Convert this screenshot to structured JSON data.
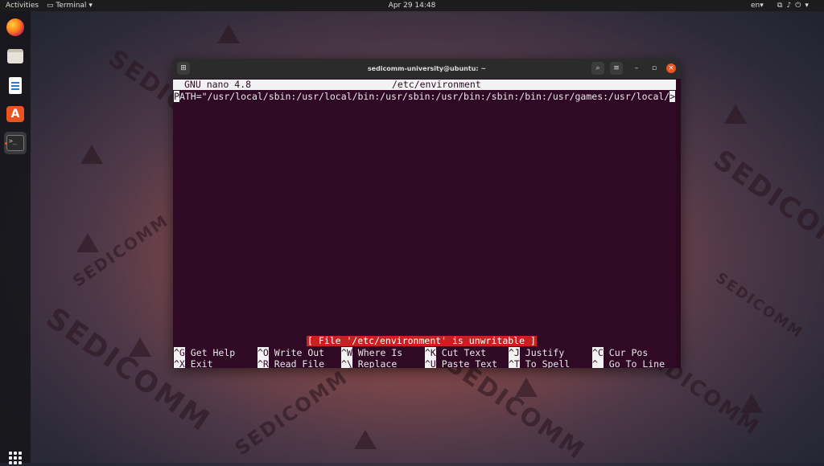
{
  "topbar": {
    "activities": "Activities",
    "app_name": "Terminal",
    "clock": "Apr 29  14:48",
    "lang": "en"
  },
  "dock": {
    "items": [
      "firefox",
      "files",
      "libreoffice-writer",
      "ubuntu-software",
      "terminal"
    ]
  },
  "window": {
    "title": "sedicomm-university@ubuntu: ~"
  },
  "nano": {
    "version": "GNU nano 4.8",
    "filename": "/etc/environment",
    "line1_first_char": "P",
    "line1_rest": "ATH=\"/usr/local/sbin:/usr/local/bin:/usr/sbin:/usr/bin:/sbin:/bin:/usr/games:/usr/local/",
    "line1_more": ">",
    "status": "[ File '/etc/environment' is unwritable ]",
    "shortcuts_row1": [
      {
        "key": "^G",
        "label": "Get Help"
      },
      {
        "key": "^O",
        "label": "Write Out"
      },
      {
        "key": "^W",
        "label": "Where Is"
      },
      {
        "key": "^K",
        "label": "Cut Text"
      },
      {
        "key": "^J",
        "label": "Justify"
      },
      {
        "key": "^C",
        "label": "Cur Pos"
      }
    ],
    "shortcuts_row2": [
      {
        "key": "^X",
        "label": "Exit"
      },
      {
        "key": "^R",
        "label": "Read File"
      },
      {
        "key": "^\\",
        "label": "Replace"
      },
      {
        "key": "^U",
        "label": "Paste Text"
      },
      {
        "key": "^T",
        "label": "To Spell"
      },
      {
        "key": "^_",
        "label": "Go To Line"
      }
    ]
  },
  "colors": {
    "terminal_bg": "#300a24",
    "accent": "#e95420",
    "status_bg": "#cc1f1f"
  },
  "wallpaper": {
    "text": "SEDICOMM"
  }
}
